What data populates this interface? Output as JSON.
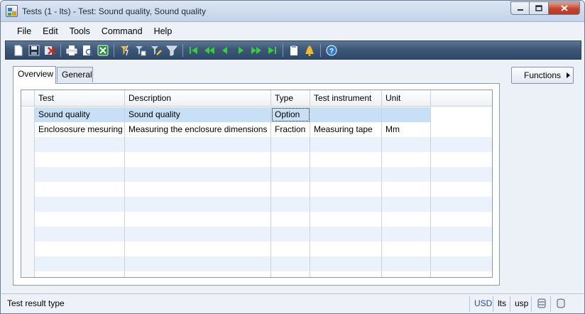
{
  "window": {
    "title": "Tests (1 - lts) - Test: Sound quality, Sound quality",
    "min_icon": "minimize-icon",
    "max_icon": "maximize-icon",
    "close_icon": "close-icon"
  },
  "menu": [
    "File",
    "Edit",
    "Tools",
    "Command",
    "Help"
  ],
  "toolbar": {
    "icons": [
      "new-icon",
      "save-icon",
      "delete-icon",
      "print-icon",
      "print-preview-icon",
      "export-excel-icon",
      "filter-by-selection-icon",
      "filter-by-grid-icon",
      "advanced-filter-icon",
      "remove-filter-icon",
      "first-record-icon",
      "previous-page-icon",
      "previous-record-icon",
      "next-record-icon",
      "next-page-icon",
      "last-record-icon",
      "document-handling-icon",
      "alert-icon",
      "help-icon"
    ]
  },
  "tabs": [
    "Overview",
    "General"
  ],
  "functions_button": "Functions",
  "grid": {
    "columns": [
      "Test",
      "Description",
      "Type",
      "Test instrument",
      "Unit"
    ],
    "rows": [
      [
        "Sound quality",
        "Sound quality",
        "Option",
        "",
        ""
      ],
      [
        "Enclososure mesuring",
        "Measuring the enclosure dimensions",
        "Fraction",
        "Measuring tape",
        "Mm"
      ]
    ]
  },
  "status": {
    "text": "Test result type",
    "currency": "USD",
    "company": "lts",
    "layer": "usp",
    "icon1": "database-icon",
    "icon2": "database-alt-icon"
  }
}
